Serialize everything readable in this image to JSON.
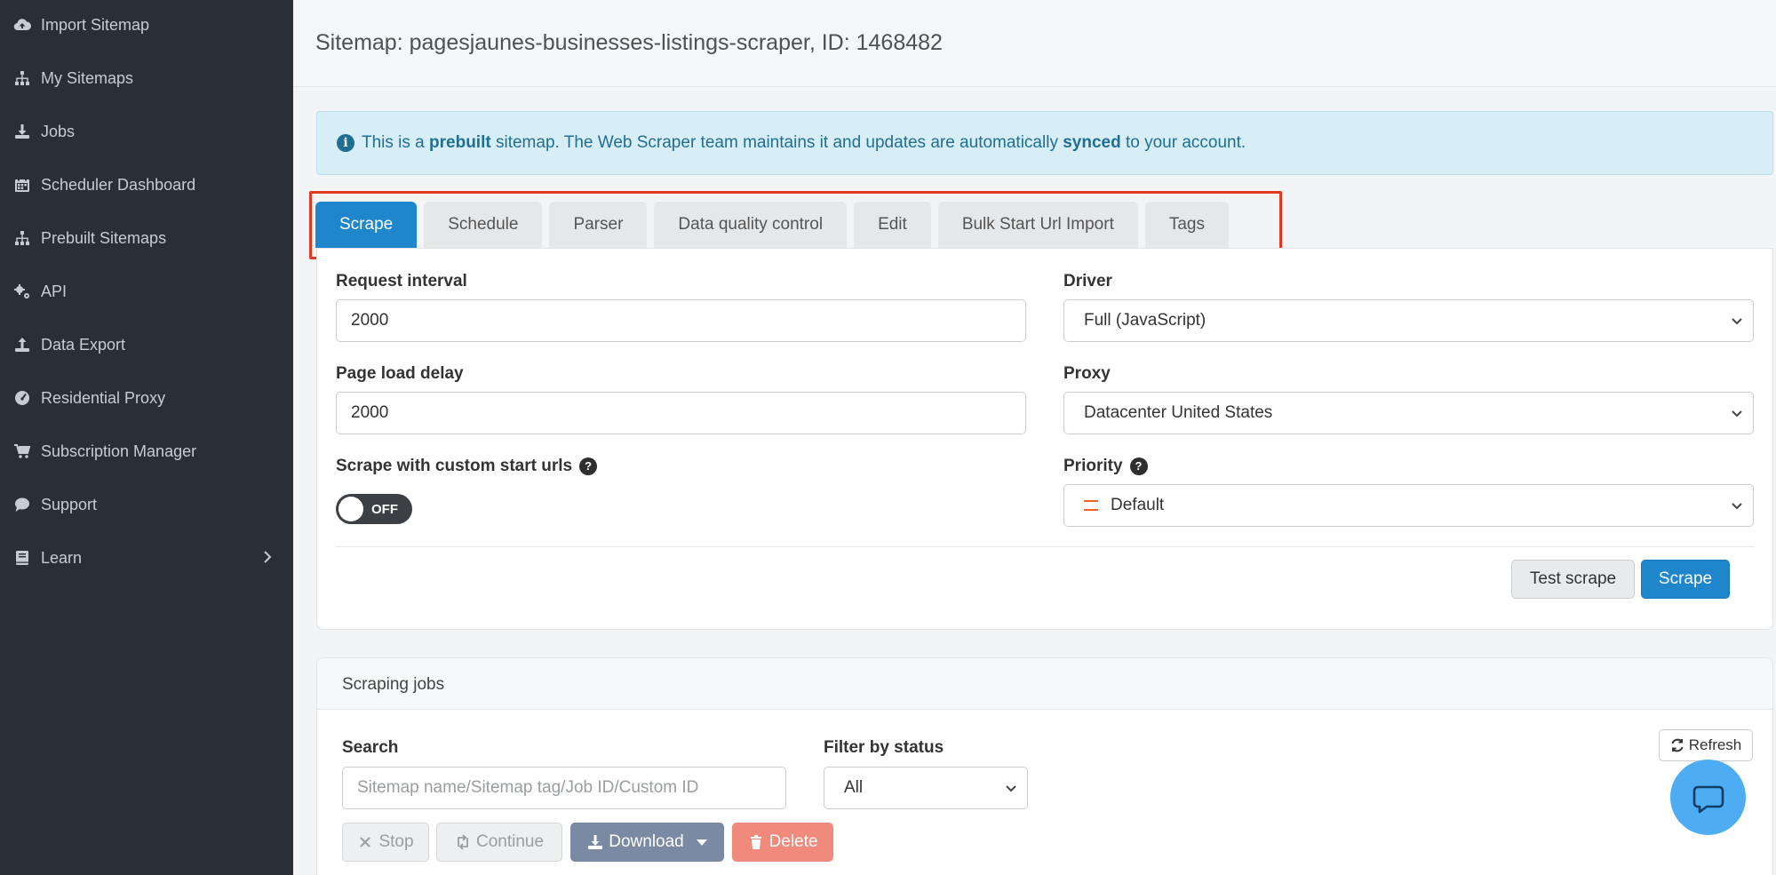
{
  "sidebar": {
    "items": [
      {
        "label": "Import Sitemap",
        "icon": "cloud-upload-icon"
      },
      {
        "label": "My Sitemaps",
        "icon": "sitemap-icon"
      },
      {
        "label": "Jobs",
        "icon": "download-icon"
      },
      {
        "label": "Scheduler Dashboard",
        "icon": "calendar-icon"
      },
      {
        "label": "Prebuilt Sitemaps",
        "icon": "sitemap-icon"
      },
      {
        "label": "API",
        "icon": "gears-icon"
      },
      {
        "label": "Data Export",
        "icon": "upload-icon"
      },
      {
        "label": "Residential Proxy",
        "icon": "gauge-icon"
      },
      {
        "label": "Subscription Manager",
        "icon": "cart-icon"
      },
      {
        "label": "Support",
        "icon": "chat-bubble-icon"
      },
      {
        "label": "Learn",
        "icon": "book-icon"
      }
    ]
  },
  "header": {
    "title": "Sitemap: pagesjaunes-businesses-listings-scraper, ID: 1468482"
  },
  "alert": {
    "text_1": "This is a ",
    "bold_1": "prebuilt",
    "text_2": " sitemap. The Web Scraper team maintains it and updates are automatically ",
    "bold_2": "synced",
    "text_3": " to your account."
  },
  "tabs": [
    {
      "label": "Scrape",
      "active": true
    },
    {
      "label": "Schedule",
      "active": false
    },
    {
      "label": "Parser",
      "active": false
    },
    {
      "label": "Data quality control",
      "active": false
    },
    {
      "label": "Edit",
      "active": false
    },
    {
      "label": "Bulk Start Url Import",
      "active": false
    },
    {
      "label": "Tags",
      "active": false
    }
  ],
  "scrape_form": {
    "request_interval_label": "Request interval",
    "request_interval_value": "2000",
    "page_load_delay_label": "Page load delay",
    "page_load_delay_value": "2000",
    "custom_start_urls_label": "Scrape with custom start urls",
    "toggle_state": "OFF",
    "driver_label": "Driver",
    "driver_value": "Full (JavaScript)",
    "proxy_label": "Proxy",
    "proxy_value": "Datacenter United States",
    "priority_label": "Priority",
    "priority_value": "Default",
    "test_scrape_label": "Test scrape",
    "scrape_label": "Scrape"
  },
  "jobs": {
    "title": "Scraping jobs",
    "search_label": "Search",
    "search_placeholder": "Sitemap name/Sitemap tag/Job ID/Custom ID",
    "filter_label": "Filter by status",
    "filter_value": "All",
    "refresh_label": "Refresh",
    "stop_label": "Stop",
    "continue_label": "Continue",
    "download_label": "Download",
    "delete_label": "Delete"
  },
  "colors": {
    "primary": "#1f86cc",
    "sidebar_bg": "#2a2e35",
    "highlight": "#e23a22",
    "delete": "#f08a7c",
    "download": "#7a8aa3"
  }
}
